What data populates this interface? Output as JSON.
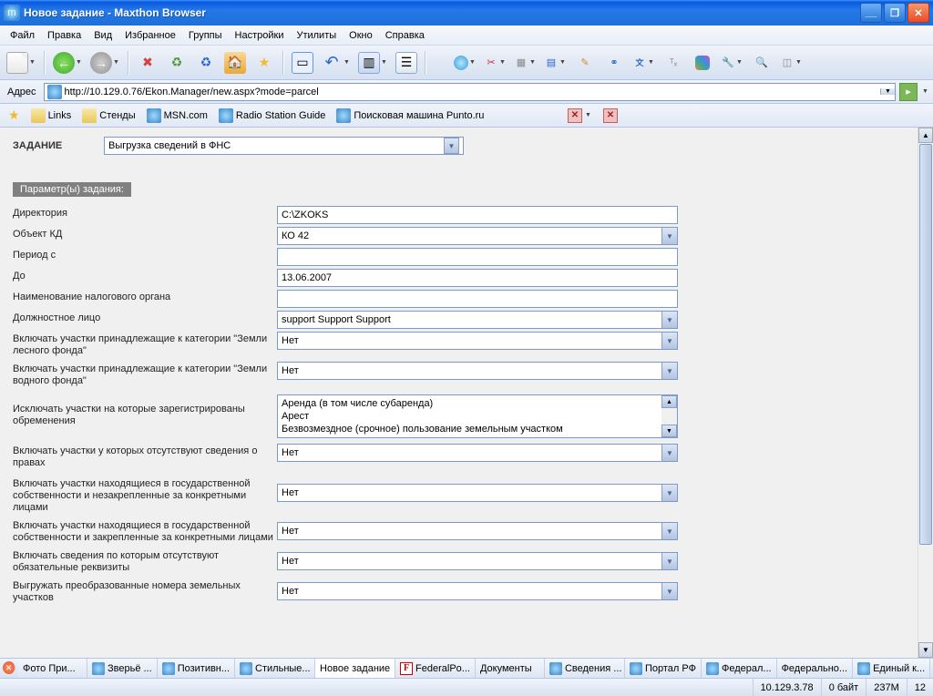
{
  "window": {
    "title": "Новое задание - Maxthon Browser"
  },
  "menu": {
    "file": "Файл",
    "edit": "Правка",
    "view": "Вид",
    "favorites": "Избранное",
    "groups": "Группы",
    "settings": "Настройки",
    "utilities": "Утилиты",
    "window": "Окно",
    "help": "Справка"
  },
  "address": {
    "label": "Адрес",
    "url": "http://10.129.0.76/Ekon.Manager/new.aspx?mode=parcel"
  },
  "bookmarks": {
    "links": "Links",
    "stands": "Стенды",
    "msn": "MSN.com",
    "radio": "Radio Station Guide",
    "punto": "Поисковая машина Punto.ru"
  },
  "page": {
    "task_label": "ЗАДАНИЕ",
    "task_value": "Выгрузка сведений в ФНС",
    "params_header": "Параметр(ы) задания:",
    "fields": {
      "directory": {
        "label": "Директория",
        "value": "C:\\ZKOKS"
      },
      "object_kd": {
        "label": "Объект КД",
        "value": "КО 42"
      },
      "period_from": {
        "label": "Период с",
        "value": ""
      },
      "period_to": {
        "label": "До",
        "value": "13.06.2007"
      },
      "tax_authority": {
        "label": "Наименование налогового органа",
        "value": ""
      },
      "official": {
        "label": "Должностное лицо",
        "value": "support Support Support"
      },
      "forest_land": {
        "label": "Включать участки принадлежащие к категории \"Земли лесного фонда\"",
        "value": "Нет"
      },
      "water_land": {
        "label": "Включать участки принадлежащие к категории \"Земли водного фонда\"",
        "value": "Нет"
      },
      "exclude_encumbrance": {
        "label": "Исключать участки на которые зарегистрированы обременения",
        "items": [
          "Аренда (в том числе субаренда)",
          "Арест",
          "Безвозмездное (срочное) пользование земельным участком"
        ]
      },
      "no_rights": {
        "label": "Включать участки у которых отсутствуют сведения о правах",
        "value": "Нет"
      },
      "state_unassigned": {
        "label": "Включать участки находящиеся в государственной собственности и незакрепленные за конкретными лицами",
        "value": "Нет"
      },
      "state_assigned": {
        "label": "Включать участки находящиеся в государственной собственности и закрепленные за конкретными лицами",
        "value": "Нет"
      },
      "missing_required": {
        "label": "Включать сведения по которым отсутствуют обязательные реквизиты",
        "value": "Нет"
      },
      "export_converted": {
        "label": "Выгружать преобразованные номера земельных участков",
        "value": "Нет"
      }
    }
  },
  "tabs": {
    "t0": "Фото При...",
    "t1": "Зверьё ...",
    "t2": "Позитивн...",
    "t3": "Стильные...",
    "t4": "Новое задание",
    "t5": "FederalPo...",
    "t6": "Документы",
    "t7": "Сведения ...",
    "t8": "Портал РФ",
    "t9": "Федерал...",
    "t10": "Федерально...",
    "t11": "Единый к..."
  },
  "status": {
    "ip": "10.129.3.78",
    "bytes": "0 байт",
    "mem": "237M",
    "count": "12"
  }
}
